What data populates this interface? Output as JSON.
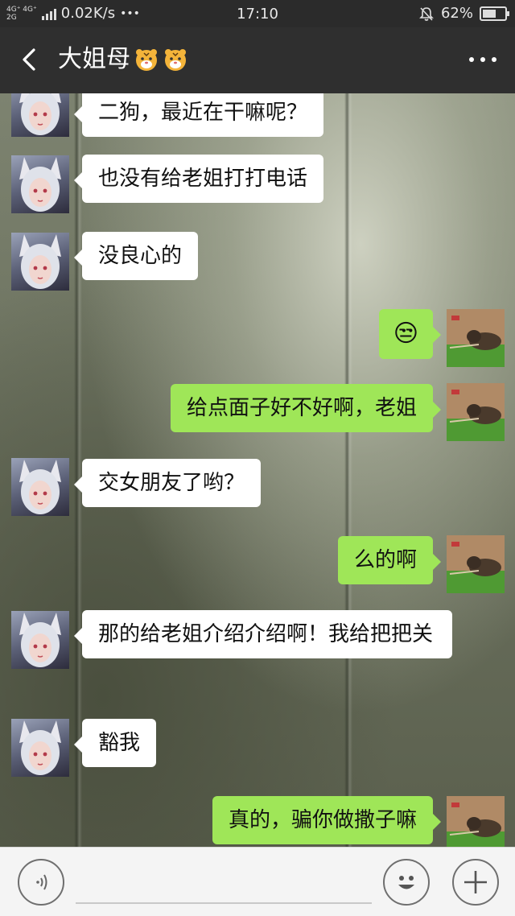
{
  "status_bar": {
    "network_top": "4G⁺ 4G⁺",
    "network_bottom": "2G",
    "speed": "0.02K/s",
    "dots": "•••",
    "time": "17:10",
    "battery": "62%",
    "battery_level": 0.62
  },
  "header": {
    "title": "大姐母",
    "title_emoji": "🐯🐯"
  },
  "messages": [
    {
      "side": "left",
      "text": "二狗，最近在干嘛呢？"
    },
    {
      "side": "left",
      "text": "也没有给老姐打打电话"
    },
    {
      "side": "left",
      "text": "没良心的"
    },
    {
      "side": "right",
      "text": "😒"
    },
    {
      "side": "right",
      "text": "给点面子好不好啊，老姐"
    },
    {
      "side": "left",
      "text": "交女朋友了哟？"
    },
    {
      "side": "right",
      "text": "么的啊"
    },
    {
      "side": "left",
      "text": "那的给老姐介绍介绍啊！我给把把关"
    },
    {
      "side": "left",
      "text": "豁我"
    },
    {
      "side": "right",
      "text": "真的，骗你做撒子嘛"
    }
  ],
  "colors": {
    "bubble_left": "#ffffff",
    "bubble_right": "#9fe658",
    "header_bg": "#2f2f2f",
    "status_bg": "#2b2b2b"
  },
  "icons": {
    "back": "chevron-left-icon",
    "more": "more-dots-icon",
    "voice": "voice-icon",
    "emoji": "emoji-icon",
    "plus": "plus-icon"
  }
}
